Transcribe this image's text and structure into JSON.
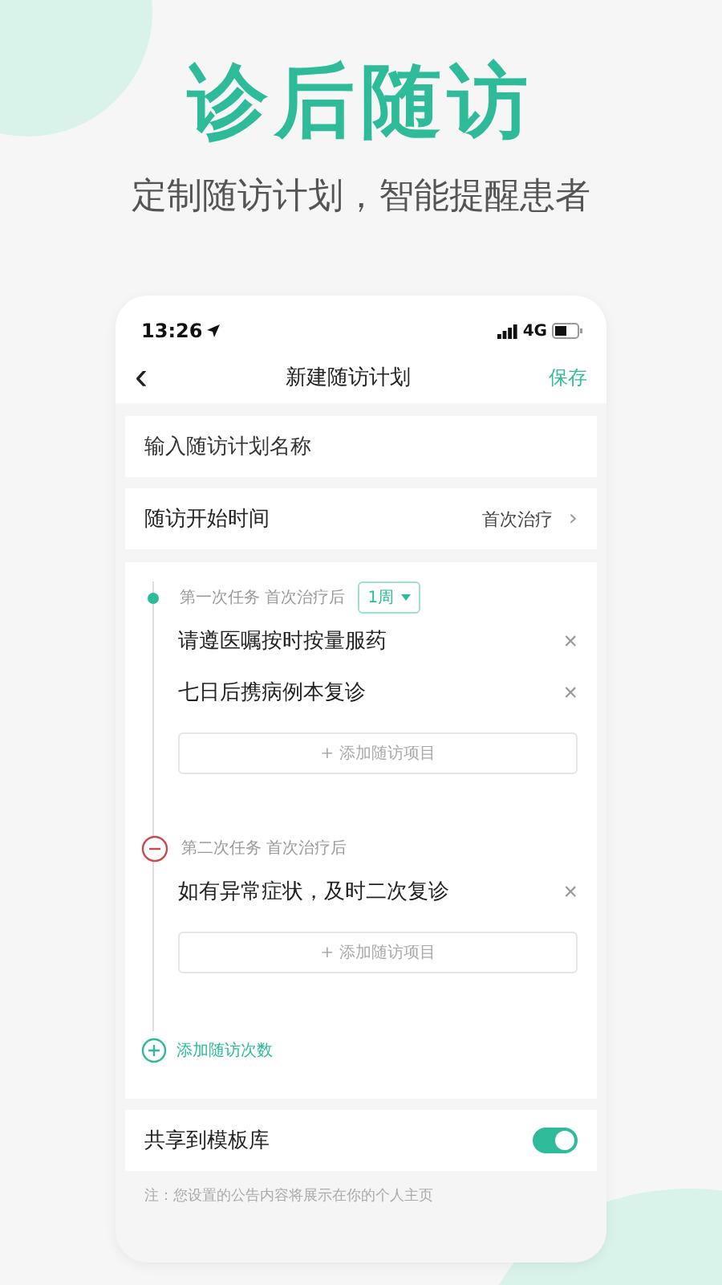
{
  "hero": {
    "title": "诊后随访",
    "subtitle": "定制随访计划，智能提醒患者"
  },
  "status_bar": {
    "time": "13:26",
    "network": "4G"
  },
  "nav": {
    "back": "‹",
    "title": "新建随访计划",
    "action": "保存"
  },
  "name_field": {
    "placeholder": "输入随访计划名称"
  },
  "start_time": {
    "label": "随访开始时间",
    "value": "首次治疗",
    "chevron": "›"
  },
  "tasks": [
    {
      "kind": "dot",
      "title": "第一次任务",
      "after": "首次治疗后",
      "interval": "1周",
      "items": [
        {
          "text": "请遵医嘱按时按量服药",
          "remove": "×"
        },
        {
          "text": "七日后携病例本复诊",
          "remove": "×"
        }
      ],
      "add": "+ 添加随访项目"
    },
    {
      "kind": "remove",
      "title": "第二次任务",
      "after": "首次治疗后",
      "items": [
        {
          "text": "如有异常症状，及时二次复诊",
          "remove": "×"
        }
      ],
      "add": "+ 添加随访项目"
    }
  ],
  "add_task": "添加随访次数",
  "share": {
    "label": "共享到模板库",
    "on": true
  },
  "note": "注：您设置的公告内容将展示在你的个人主页"
}
